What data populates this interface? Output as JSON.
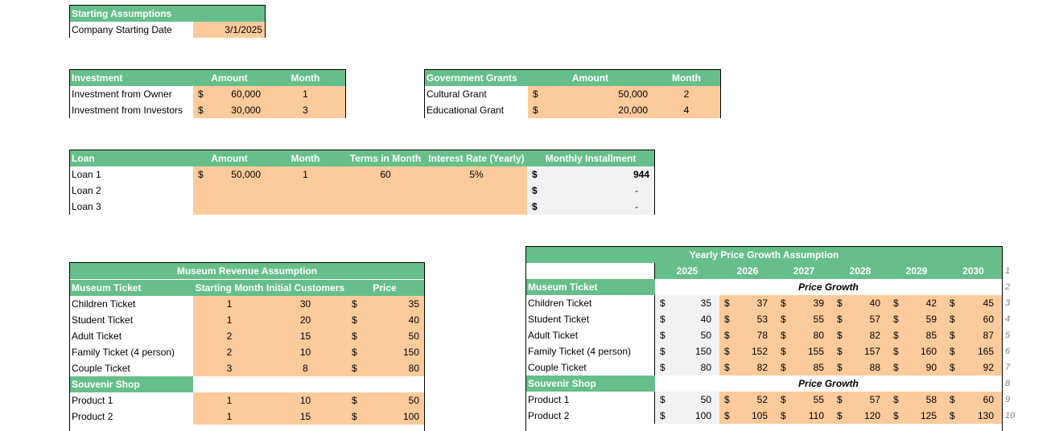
{
  "starting": {
    "title": "Starting Assumptions",
    "label": "Company Starting Date",
    "value": "3/1/2025"
  },
  "investment": {
    "headers": [
      "Investment",
      "Amount",
      "Month"
    ],
    "rows": [
      {
        "name": "Investment from Owner",
        "cur": "$",
        "amount": "60,000",
        "month": "1"
      },
      {
        "name": "Investment from Investors",
        "cur": "$",
        "amount": "30,000",
        "month": "3"
      }
    ]
  },
  "grants": {
    "headers": [
      "Government Grants",
      "Amount",
      "Month"
    ],
    "rows": [
      {
        "name": "Cultural Grant",
        "cur": "$",
        "amount": "50,000",
        "month": "2"
      },
      {
        "name": "Educational Grant",
        "cur": "$",
        "amount": "20,000",
        "month": "4"
      }
    ]
  },
  "loan": {
    "headers": [
      "Loan",
      "Amount",
      "Month",
      "Terms in Month",
      "Interest Rate (Yearly)",
      "Monthly Installment"
    ],
    "rows": [
      {
        "name": "Loan 1",
        "cur": "$",
        "amount": "50,000",
        "month": "1",
        "terms": "60",
        "rate": "5%",
        "icur": "$",
        "installment": "944"
      },
      {
        "name": "Loan 2",
        "cur": "",
        "amount": "",
        "month": "",
        "terms": "",
        "rate": "",
        "icur": "$",
        "installment": "-"
      },
      {
        "name": "Loan 3",
        "cur": "",
        "amount": "",
        "month": "",
        "terms": "",
        "rate": "",
        "icur": "$",
        "installment": "-"
      }
    ]
  },
  "revenue": {
    "title": "Museum Revenue Assumption",
    "headers": [
      "Museum Ticket",
      "Starting Month",
      "Initial Customers",
      "Price"
    ],
    "tickets": [
      {
        "name": "Children Ticket",
        "month": "1",
        "customers": "30",
        "cur": "$",
        "price": "35"
      },
      {
        "name": "Student Ticket",
        "month": "1",
        "customers": "20",
        "cur": "$",
        "price": "40"
      },
      {
        "name": "Adult Ticket",
        "month": "2",
        "customers": "15",
        "cur": "$",
        "price": "50"
      },
      {
        "name": "Family Ticket (4 person)",
        "month": "2",
        "customers": "10",
        "cur": "$",
        "price": "150"
      },
      {
        "name": "Couple Ticket",
        "month": "3",
        "customers": "8",
        "cur": "$",
        "price": "80"
      }
    ],
    "shop_header": "Souvenir Shop",
    "products": [
      {
        "name": "Product 1",
        "month": "1",
        "customers": "10",
        "cur": "$",
        "price": "50"
      },
      {
        "name": "Product 2",
        "month": "1",
        "customers": "15",
        "cur": "$",
        "price": "100"
      }
    ]
  },
  "growth": {
    "title": "Yearly Price Growth Assumption",
    "years": [
      "2025",
      "2026",
      "2027",
      "2028",
      "2029",
      "2030"
    ],
    "ticket_header": "Museum Ticket",
    "price_growth_label": "Price Growth",
    "shop_header": "Souvenir Shop",
    "currency": "$",
    "tickets": [
      {
        "name": "Children Ticket",
        "values": [
          "35",
          "37",
          "39",
          "40",
          "42",
          "45"
        ]
      },
      {
        "name": "Student Ticket",
        "values": [
          "40",
          "53",
          "55",
          "57",
          "59",
          "60"
        ]
      },
      {
        "name": "Adult Ticket",
        "values": [
          "50",
          "78",
          "80",
          "82",
          "85",
          "87"
        ]
      },
      {
        "name": "Family Ticket (4 person)",
        "values": [
          "150",
          "152",
          "155",
          "157",
          "160",
          "165"
        ]
      },
      {
        "name": "Couple Ticket",
        "values": [
          "80",
          "82",
          "85",
          "88",
          "90",
          "92"
        ]
      }
    ],
    "products": [
      {
        "name": "Product 1",
        "values": [
          "50",
          "52",
          "55",
          "57",
          "58",
          "60"
        ]
      },
      {
        "name": "Product 2",
        "values": [
          "100",
          "105",
          "110",
          "120",
          "125",
          "130"
        ]
      }
    ],
    "row_numbers": [
      "1",
      "2",
      "3",
      "4",
      "5",
      "6",
      "7",
      "8",
      "9",
      "10"
    ]
  }
}
